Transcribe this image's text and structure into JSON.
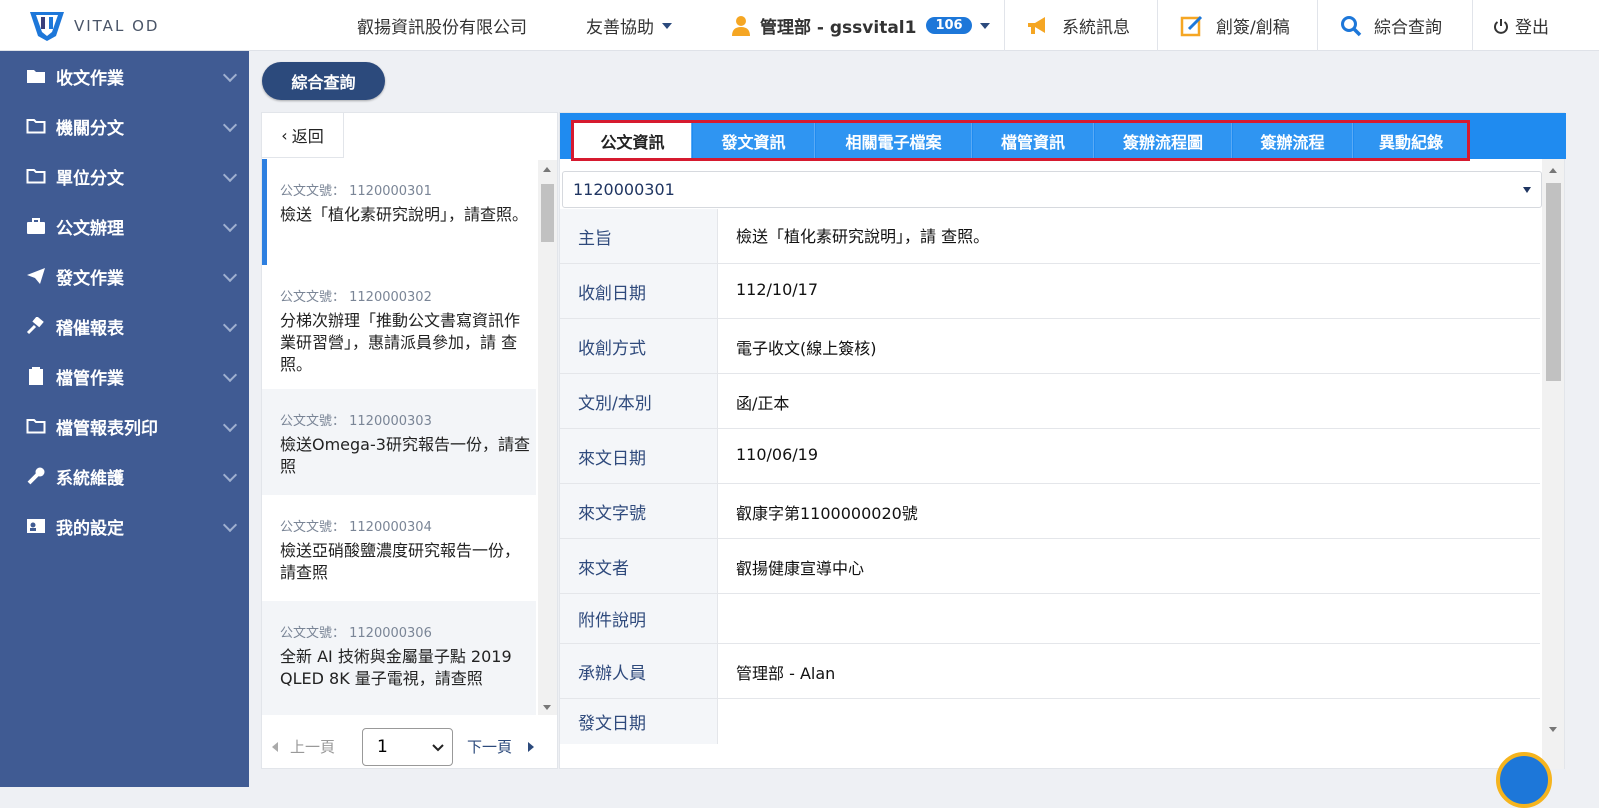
{
  "header": {
    "logo_text": "VITAL OD",
    "company": "叡揚資訊股份有限公司",
    "friendly_help": "友善協助",
    "user": "管理部 - gssvital1",
    "user_badge": "106",
    "system_msg": "系統訊息",
    "create_sign": "創簽/創稿",
    "search": "綜合查詢",
    "logout": "登出"
  },
  "sidebar": {
    "items": [
      {
        "label": "收文作業",
        "icon": "folder-filled-icon"
      },
      {
        "label": "機關分文",
        "icon": "folder-outline-icon"
      },
      {
        "label": "單位分文",
        "icon": "folder-outline-icon"
      },
      {
        "label": "公文辦理",
        "icon": "briefcase-icon"
      },
      {
        "label": "發文作業",
        "icon": "paper-plane-icon"
      },
      {
        "label": "稽催報表",
        "icon": "gavel-icon"
      },
      {
        "label": "檔管作業",
        "icon": "document-icon"
      },
      {
        "label": "檔管報表列印",
        "icon": "folder-outline-icon"
      },
      {
        "label": "系統維護",
        "icon": "wrench-icon"
      },
      {
        "label": "我的設定",
        "icon": "id-card-icon"
      }
    ]
  },
  "main": {
    "search_button": "綜合查詢",
    "back_label": "返回"
  },
  "list": {
    "items": [
      {
        "no_label": "公文文號： 1120000301",
        "subject": "檢送「植化素研究說明」，請查照。"
      },
      {
        "no_label": "公文文號： 1120000302",
        "subject": "分梯次辦理「推動公文書寫資訊作業研習營」，惠請派員參加，請 查照。"
      },
      {
        "no_label": "公文文號： 1120000303",
        "subject": "檢送Omega-3研究報告一份，請查照"
      },
      {
        "no_label": "公文文號： 1120000304",
        "subject": "檢送亞硝酸鹽濃度研究報告一份，請查照"
      },
      {
        "no_label": "公文文號： 1120000306",
        "subject": "全新 AI 技術與金屬量子點 2019 QLED 8K 量子電視，請查照"
      }
    ],
    "pager": {
      "prev": "上一頁",
      "page": "1",
      "next": "下一頁"
    }
  },
  "detail": {
    "tabs": [
      "公文資訊",
      "發文資訊",
      "相關電子檔案",
      "檔管資訊",
      "簽辦流程圖",
      "簽辦流程",
      "異動紀錄"
    ],
    "doc_number": "1120000301",
    "fields": [
      {
        "label": "主旨",
        "value": "檢送「植化素研究說明」，請 查照。"
      },
      {
        "label": "收創日期",
        "value": "112/10/17"
      },
      {
        "label": "收創方式",
        "value": "電子收文(線上簽核)"
      },
      {
        "label": "文別/本別",
        "value": "函/正本"
      },
      {
        "label": "來文日期",
        "value": "110/06/19"
      },
      {
        "label": "來文字號",
        "value": "叡康字第1100000020號"
      },
      {
        "label": "來文者",
        "value": "叡揚健康宣導中心"
      },
      {
        "label": "附件說明",
        "value": ""
      },
      {
        "label": "承辦人員",
        "value": "管理部 - Alan"
      },
      {
        "label": "發文日期",
        "value": ""
      }
    ]
  }
}
